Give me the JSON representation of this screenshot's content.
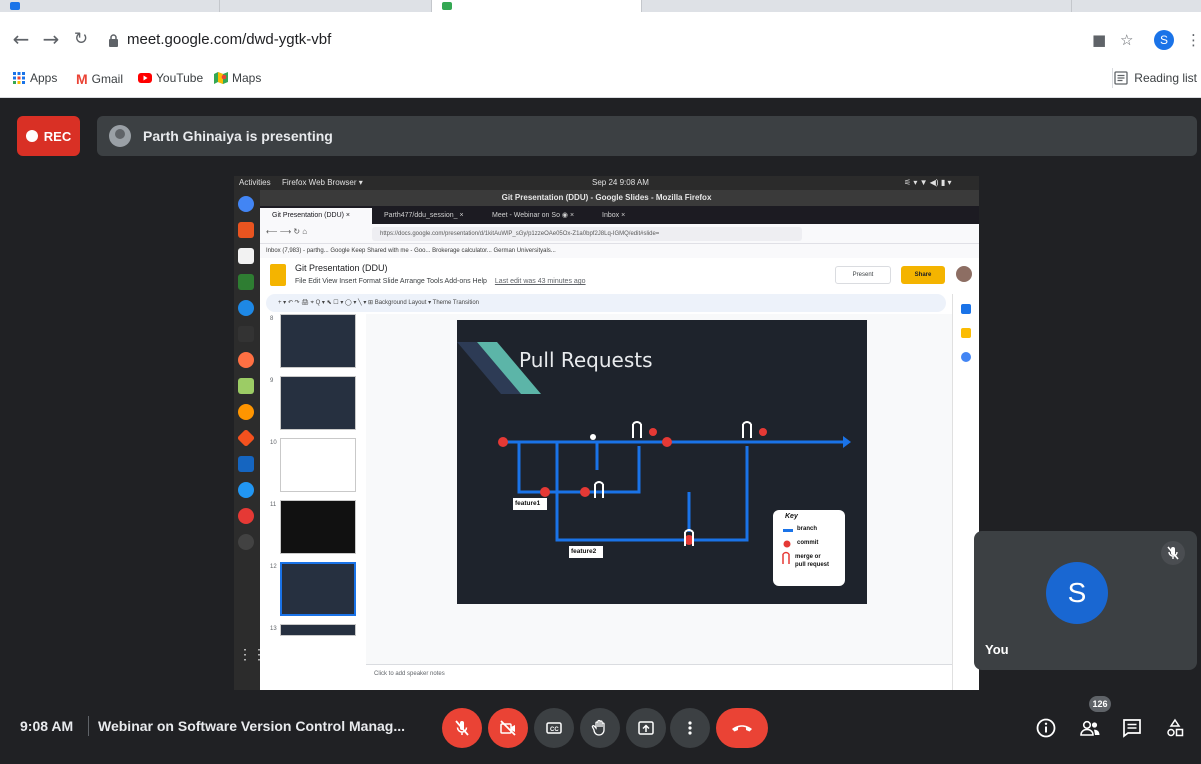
{
  "browser": {
    "url": "meet.google.com/dwd-ygtk-vbf",
    "profile_initial": "S",
    "bookmarks": [
      "Apps",
      "Gmail",
      "YouTube",
      "Maps"
    ],
    "reading_list": "Reading list"
  },
  "meet": {
    "rec_label": "REC",
    "presenting_text": "Parth Ghinaiya is presenting",
    "self_name": "You",
    "self_initial": "S",
    "time": "9:08 AM",
    "meeting_name": "Webinar on Software Version Control Manag...",
    "participant_count": "126"
  },
  "shared_screen": {
    "ubuntu_activities": "Activities",
    "ubuntu_app": "Firefox Web Browser ▾",
    "ubuntu_clock": "Sep 24  9:08 AM",
    "window_title": "Git Presentation (DDU) - Google Slides - Mozilla Firefox",
    "ff_tabs": [
      "Git Presentation (DDU) ×",
      "Parth477/ddu_session_ ×",
      "Meet - Webinar on So ◉ ×",
      "Inbox ×"
    ],
    "ff_url": "https://docs.google.com/presentation/d/1kitAuWlP_sGy/p1zzeOAe05Ox-Z1a0bpf2J8Lq-IGMQ/edit#slide=",
    "ff_bookmarks": "Inbox (7,983) - parthg...   Google Keep   Shared with me - Goo...   Brokerage calculator...   German Universityals...",
    "doc_title": "Git Presentation (DDU)",
    "doc_menu": "File  Edit  View  Insert  Format  Slide  Arrange  Tools  Add-ons  Help",
    "last_edit": "Last edit was 43 minutes ago",
    "present_label": "Present",
    "share_label": "Share",
    "toolbar_text": "+ ▾  ↶ ↷  🖨  ⌖  Q ▾   ⬉  ☐ ▾  ◯ ▾  ╲ ▾   ⊞   Background    Layout ▾    Theme    Transition",
    "speaker_notes": "Click to add speaker notes",
    "thumb_numbers": [
      "8",
      "9",
      "10",
      "11",
      "12",
      "13"
    ],
    "slide": {
      "title": "Pull Requests",
      "labels": [
        "feature1",
        "feature2"
      ],
      "key_title": "Key",
      "key_items": [
        "branch",
        "commit",
        "merge or",
        "pull request"
      ]
    }
  },
  "colors": {
    "rec_red": "#d93025",
    "hangup_red": "#ea4335",
    "avatar_blue": "#1967d2",
    "branch_blue": "#1a73e8",
    "commit_red": "#e53935"
  }
}
